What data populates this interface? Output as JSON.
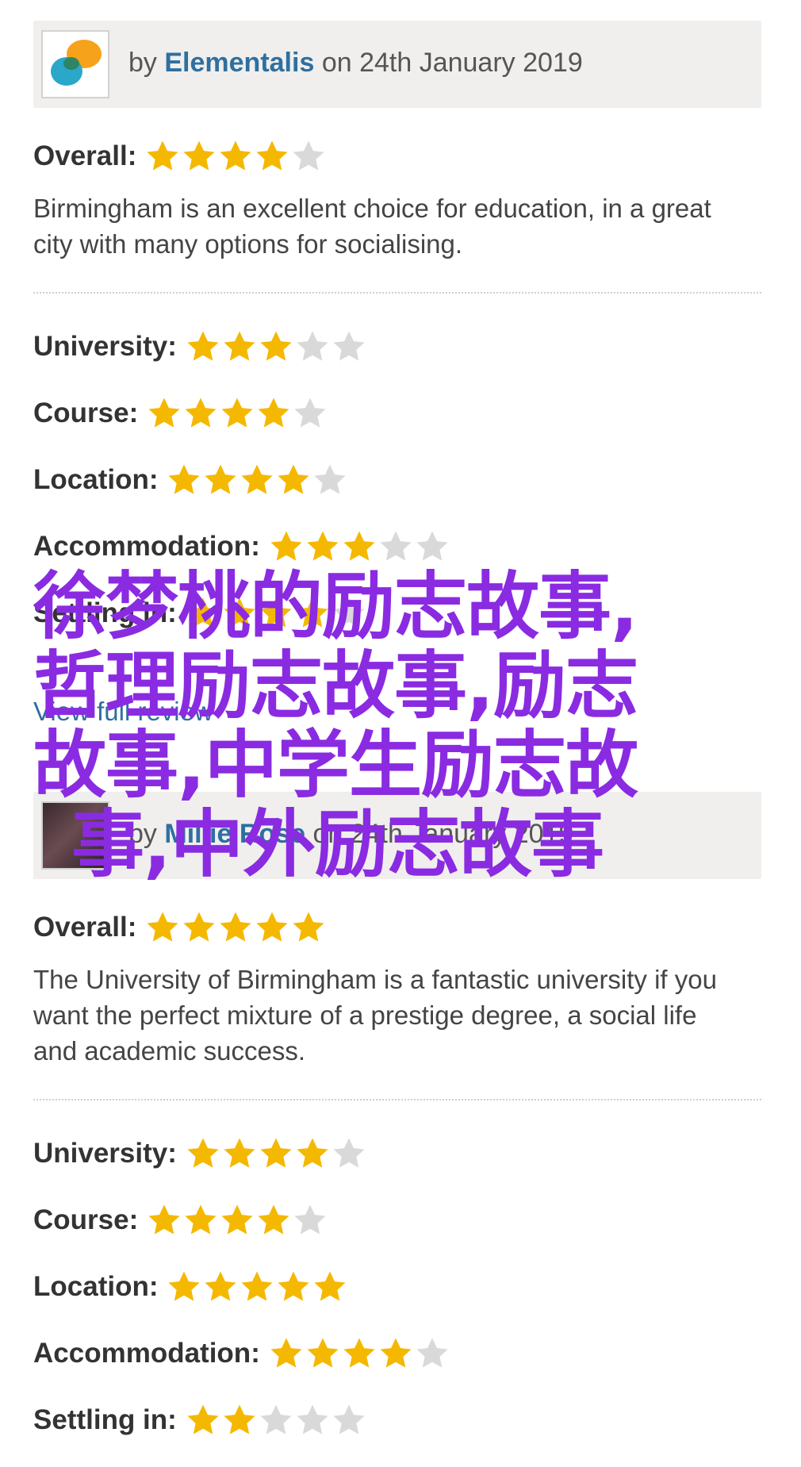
{
  "reviews": [
    {
      "by_prefix": "by",
      "author": "Elementalis",
      "date_text": "on 24th January 2019",
      "avatar": "colorful-bubbles-avatar-icon",
      "overall": {
        "label": "Overall:",
        "stars": 4,
        "max": 5
      },
      "comment": "Birmingham is an excellent choice for education, in a great city with many options for socialising.",
      "ratings": [
        {
          "label": "University:",
          "stars": 3,
          "max": 5
        },
        {
          "label": "Course:",
          "stars": 4,
          "max": 5
        },
        {
          "label": "Location:",
          "stars": 4,
          "max": 5
        },
        {
          "label": "Accommodation:",
          "stars": 3,
          "max": 5
        },
        {
          "label": "Settling in:",
          "stars": 4,
          "max": 5
        }
      ],
      "view_link": "View full review"
    },
    {
      "by_prefix": "by",
      "author": "Millie Rose",
      "date_text": "on 24th January 2019",
      "avatar": "user-photo-avatar",
      "overall": {
        "label": "Overall:",
        "stars": 5,
        "max": 5
      },
      "comment": "The University of Birmingham is a fantastic university if you want the perfect mixture of a prestige degree, a social life and academic success.",
      "ratings": [
        {
          "label": "University:",
          "stars": 4,
          "max": 5
        },
        {
          "label": "Course:",
          "stars": 4,
          "max": 5
        },
        {
          "label": "Location:",
          "stars": 5,
          "max": 5
        },
        {
          "label": "Accommodation:",
          "stars": 4,
          "max": 5
        },
        {
          "label": "Settling in:",
          "stars": 2,
          "max": 5
        }
      ]
    }
  ],
  "overlay_lines": [
    "徐梦桃的励志故事,",
    "哲理励志故事,励志",
    "故事,中学生励志故",
    "事,中外励志故事"
  ],
  "colors": {
    "star_filled": "#f5b800",
    "star_empty": "#d9d9d9",
    "link": "#2f6fa0",
    "overlay": "#8a2be2"
  }
}
